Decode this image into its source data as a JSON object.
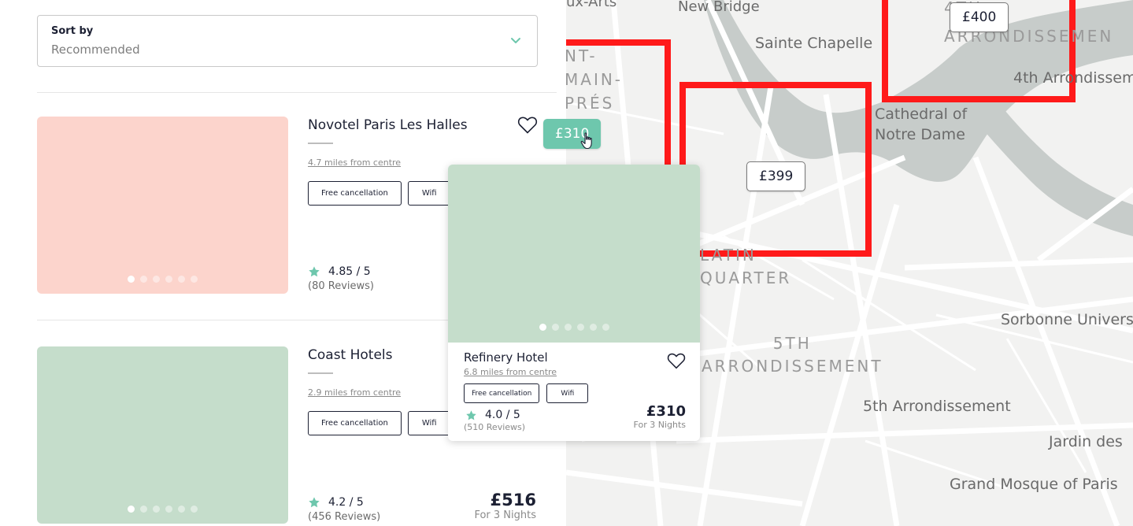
{
  "sort": {
    "label": "Sort by",
    "value": "Recommended"
  },
  "hotels": [
    {
      "name": "Novotel Paris Les Halles",
      "distance": "4.7 miles from centre",
      "tags": [
        "Free cancellation",
        "Wifi"
      ],
      "rating": "4.85 / 5",
      "reviews": "(80 Reviews)",
      "image_color": "#fcd4cc",
      "image_dots": 6,
      "active_dot": 1
    },
    {
      "name": "Coast Hotels",
      "distance": "2.9 miles from centre",
      "tags": [
        "Free cancellation",
        "Wifi"
      ],
      "rating": "4.2 / 5",
      "reviews": "(456 Reviews)",
      "price": "£516",
      "price_note": "For 3 Nights",
      "image_color": "#c5ddcb",
      "image_dots": 6,
      "active_dot": 1
    }
  ],
  "popup": {
    "name": "Refinery Hotel",
    "distance": "6.8 miles from centre",
    "tags": [
      "Free cancellation",
      "Wifi"
    ],
    "rating": "4.0 / 5",
    "reviews": "(510 Reviews)",
    "price": "£310",
    "price_note": "For 3 Nights",
    "image_color": "#c5ddcb",
    "image_dots": 6,
    "active_dot": 1
  },
  "map": {
    "pins": {
      "active": "£310",
      "pin_399": "£399",
      "pin_400": "£400"
    },
    "labels": {
      "arts": "ux-Arts",
      "new_bridge": "New Bridge",
      "sainte_chapelle": "Sainte Chapelle",
      "district_4th": "4TH\nARRONDISSEMEN",
      "fourth_arr": "4th Arrondissem",
      "st_germain": "NT-\nMAIN-\nPRÉS",
      "notre_dame": "Cathedral of\nNotre Dame",
      "latin_quarter": "LATIN\nQUARTER",
      "district_5th": "5TH\nARRONDISSEMENT",
      "fifth_arr": "5th Arrondissement",
      "sorbonne": "Sorbonne Univers",
      "jardin": "Jardin des",
      "mosque": "Grand Mosque of Paris"
    }
  },
  "colors": {
    "accent": "#6ec7ad",
    "star": "#6ec7ad",
    "boundary": "#ff1a1a",
    "river": "#c7ccca",
    "map_bg": "#f2f2f1"
  },
  "icons": [
    "chevron-down-icon",
    "heart-icon",
    "star-icon",
    "pointer-cursor-icon",
    "map-pin-icon"
  ]
}
